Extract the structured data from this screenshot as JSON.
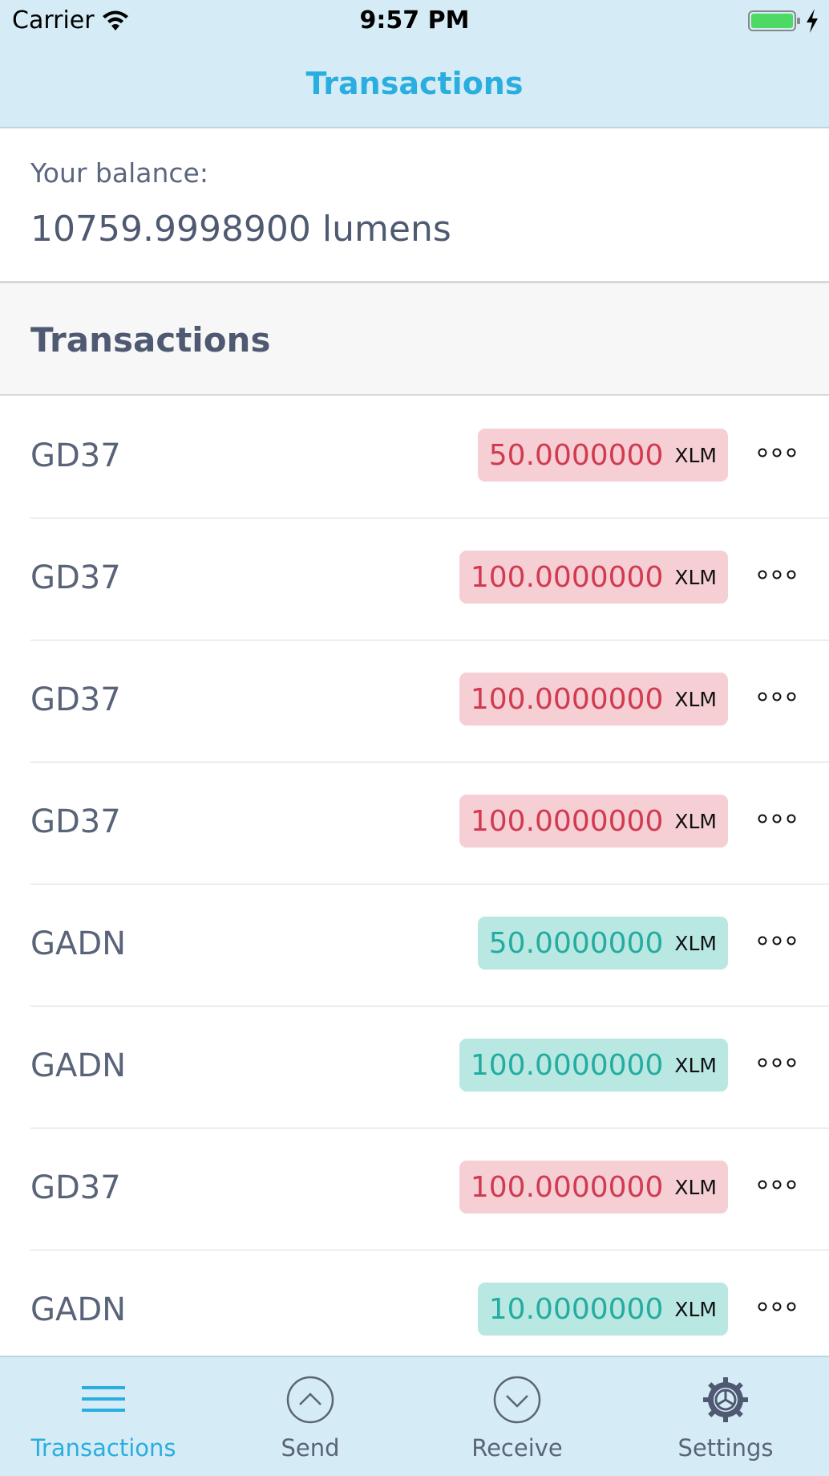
{
  "status_bar": {
    "carrier": "Carrier",
    "time": "9:57 PM",
    "battery_icon": "battery-full-icon",
    "wifi_icon": "wifi-icon",
    "charging_icon": "bolt-icon"
  },
  "nav": {
    "title": "Transactions"
  },
  "balance": {
    "label": "Your balance:",
    "value": "10759.9998900 lumens"
  },
  "section": {
    "title": "Transactions"
  },
  "colors": {
    "accent": "#2aaee0",
    "negative_text": "#d23a51",
    "negative_bg": "#f5cfd4",
    "positive_text": "#24aca0",
    "positive_bg": "#b9e8e3",
    "bar_bg": "#d5ecf6"
  },
  "transactions": [
    {
      "account": "GD37",
      "amount": "50.0000000",
      "unit": "XLM",
      "direction": "negative"
    },
    {
      "account": "GD37",
      "amount": "100.0000000",
      "unit": "XLM",
      "direction": "negative"
    },
    {
      "account": "GD37",
      "amount": "100.0000000",
      "unit": "XLM",
      "direction": "negative"
    },
    {
      "account": "GD37",
      "amount": "100.0000000",
      "unit": "XLM",
      "direction": "negative"
    },
    {
      "account": "GADN",
      "amount": "50.0000000",
      "unit": "XLM",
      "direction": "positive"
    },
    {
      "account": "GADN",
      "amount": "100.0000000",
      "unit": "XLM",
      "direction": "positive"
    },
    {
      "account": "GD37",
      "amount": "100.0000000",
      "unit": "XLM",
      "direction": "negative"
    },
    {
      "account": "GADN",
      "amount": "10.0000000",
      "unit": "XLM",
      "direction": "positive"
    }
  ],
  "tabbar": {
    "items": [
      {
        "label": "Transactions",
        "icon": "menu-lines-icon",
        "active": true
      },
      {
        "label": "Send",
        "icon": "circle-chevron-up-icon",
        "active": false
      },
      {
        "label": "Receive",
        "icon": "circle-chevron-down-icon",
        "active": false
      },
      {
        "label": "Settings",
        "icon": "gear-icon",
        "active": false
      }
    ]
  }
}
